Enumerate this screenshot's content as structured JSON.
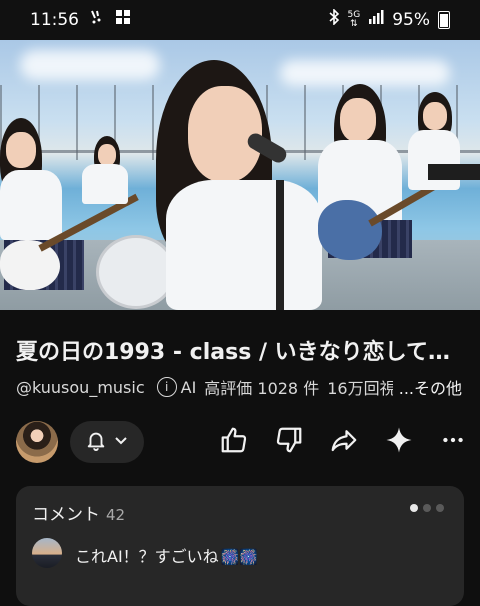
{
  "status_bar": {
    "time": "11:56",
    "network": "5G",
    "battery": "95%"
  },
  "video": {
    "title": "夏の日の1993 - class / いきなり恋してし…",
    "channel": "@kuusou_music",
    "ai_label": "AI",
    "ai_icon": "i",
    "likes_stat": "高評価 1028 件",
    "views_stat": "16万回視聴",
    "more_label": "...その他"
  },
  "actions": {
    "subscribe_icon": "bell-icon",
    "like_icon": "thumbs-up-icon",
    "dislike_icon": "thumbs-down-icon",
    "share_icon": "share-icon",
    "remix_icon": "sparkle-icon",
    "more_icon": "more-horizontal-icon"
  },
  "comments": {
    "label": "コメント",
    "count": "42",
    "top_comment": "これAI！？すごいね",
    "top_comment_emoji": "🎆🎆"
  },
  "colors": {
    "background": "#0f0f0f",
    "panel": "#272727",
    "text": "#f1f1f1",
    "muted": "#aaaaaa"
  }
}
